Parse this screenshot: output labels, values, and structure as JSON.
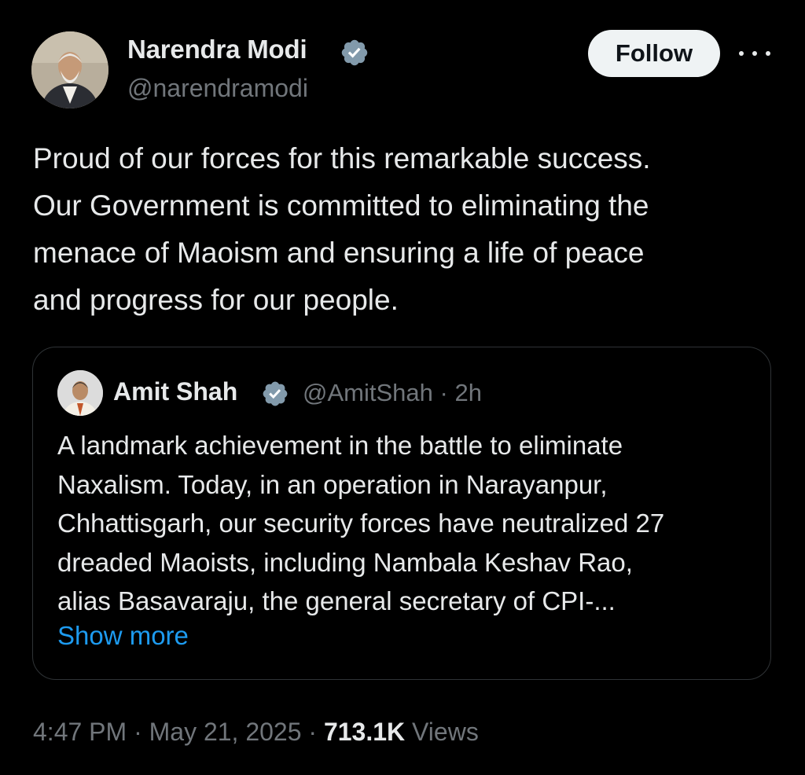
{
  "author": {
    "name": "Narendra Modi",
    "handle": "@narendramodi"
  },
  "actions": {
    "follow_label": "Follow"
  },
  "tweet": {
    "lines": [
      "Proud of our forces for this remarkable success.",
      "Our Government is committed to eliminating the",
      "menace of Maoism and ensuring a life of peace",
      "and progress for our people."
    ]
  },
  "quoted": {
    "name": "Amit Shah",
    "handle": "@AmitShah",
    "separator": "·",
    "time": "2h",
    "lines": [
      "A landmark achievement in the battle to eliminate",
      "Naxalism. Today, in an operation in Narayanpur,",
      "Chhattisgarh, our security forces have neutralized 27",
      "dreaded Maoists, including Nambala Keshav Rao,",
      "alias Basavaraju, the general secretary of CPI-..."
    ],
    "show_more_label": "Show more"
  },
  "meta": {
    "time": "4:47 PM",
    "separator": "·",
    "date": "May 21, 2025",
    "views_count": "713.1K",
    "views_label": "Views"
  },
  "icons": {
    "verified": "verified-badge-icon",
    "more": "more-options-icon"
  },
  "colors": {
    "background": "#000000",
    "text_primary": "#e7e9ea",
    "text_secondary": "#71767b",
    "link": "#1d9bf0",
    "border": "#2f3336",
    "follow_bg": "#eff3f4",
    "verified_badge": "#829aab"
  }
}
